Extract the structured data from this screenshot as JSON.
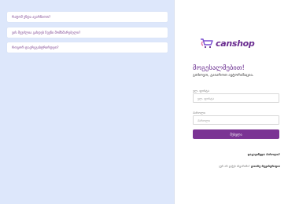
{
  "faq": {
    "items": [
      {
        "label": "რატომ უნდა ავარჩიოთ?"
      },
      {
        "label": "ვის შეუძლია გახდეს ჩვენი მომხმარებელი?"
      },
      {
        "label": "როგორ დავრეგისტრირდეთ?"
      }
    ]
  },
  "brand": {
    "name": "canshop",
    "logo_icon": "shopping-cart-logo",
    "color": "#6a2d90"
  },
  "login": {
    "title": "მოგესალმებით!",
    "subtitle": "გთხოვთ, გაიაროთ ავტორიზაცია.",
    "email_label": "ელ. ფოსტა",
    "email_placeholder": "ელ. ფოსტა",
    "password_label": "პაროლი",
    "password_placeholder": "პაროლი",
    "submit_label": "შესვლა",
    "forgot_label": "დაგავიწყდა პაროლი?",
    "register_prompt": "ჯერ არ გაქვს ანგარიში?",
    "register_link": "გაიარე რეგისტრაცია"
  },
  "colors": {
    "accent": "#7b3494",
    "left_background": "#dde7fb"
  }
}
